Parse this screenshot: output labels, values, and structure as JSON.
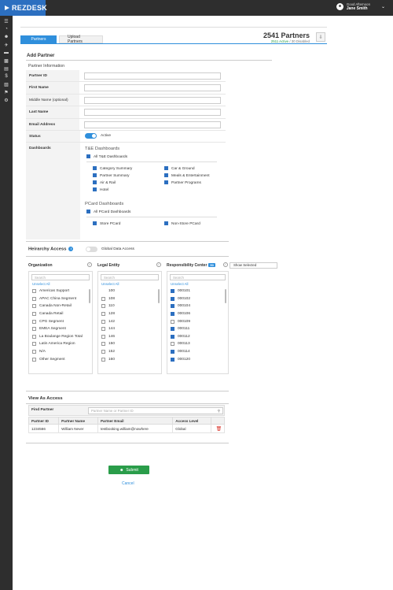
{
  "app": {
    "logo_text": "REZDESK",
    "greeting": "Good Afternoon",
    "user_name": "Jane Smith"
  },
  "sidebar": {
    "icons": [
      "menu-icon",
      "dashboard-icon",
      "user-icon",
      "plane-icon",
      "bed-icon",
      "car-icon",
      "file-icon",
      "dollar-icon",
      "book-icon",
      "flag-icon",
      "settings-icon"
    ]
  },
  "tabs": [
    {
      "label": "Partners"
    },
    {
      "label": "Upload Partners"
    }
  ],
  "summary": {
    "total": "2541 Partners",
    "active": "2511 Active",
    "sep": " / ",
    "disabled": "30 Disabled"
  },
  "add_partner": {
    "title": "Add Partner",
    "section": "Partner Information",
    "fields": [
      {
        "label": "Partner ID",
        "value": ""
      },
      {
        "label": "First Name",
        "value": ""
      },
      {
        "label": "Middle Name (optional)",
        "value": ""
      },
      {
        "label": "Last Name",
        "value": ""
      },
      {
        "label": "Email Address",
        "value": ""
      }
    ],
    "status_label": "Status",
    "status_value": "Active",
    "dashboards_label": "Dashboards"
  },
  "te": {
    "title": "T&E Dashboards",
    "all": "All T&E Dashboards",
    "left": [
      "Category Summary",
      "Partner Summary",
      "Air & Rail",
      "Hotel"
    ],
    "right": [
      "Car & Ground",
      "Meals & Entertainment",
      "Partner Programs"
    ]
  },
  "pcard": {
    "title": "PCard Dashboards",
    "all": "All PCard Dashboards",
    "items": [
      "Store PCard",
      "Non-Store PCard"
    ]
  },
  "hierarchy": {
    "title": "Heirarchy Access",
    "global_label": "Global Data Access",
    "show_selected": "Show Selected",
    "org": {
      "title": "Organization",
      "search": "Search",
      "unselect": "Unselect All",
      "items": [
        "Americas Support",
        "APAC China Segment",
        "Canada Non-Retail",
        "Canada Retail",
        "CPG Segment",
        "EMEA Segment",
        "La Boulange Region Total",
        "Latin America Region",
        "N/A",
        "Other Segment"
      ]
    },
    "legal": {
      "title": "Legal Entity",
      "search": "Search",
      "unselect": "Unselect All",
      "items": [
        "100",
        "108",
        "110",
        "128",
        "142",
        "144",
        "146",
        "150",
        "152",
        "160"
      ]
    },
    "resp": {
      "title": "Responsibility Center",
      "badge": "50",
      "search": "Search",
      "unselect": "Unselect All",
      "items": [
        {
          "v": "000101",
          "on": true
        },
        {
          "v": "000102",
          "on": true
        },
        {
          "v": "000104",
          "on": true
        },
        {
          "v": "000106",
          "on": true
        },
        {
          "v": "000109",
          "on": false
        },
        {
          "v": "000111",
          "on": true
        },
        {
          "v": "000112",
          "on": true
        },
        {
          "v": "000113",
          "on": false
        },
        {
          "v": "000114",
          "on": true
        },
        {
          "v": "000120",
          "on": true
        }
      ]
    }
  },
  "view_as": {
    "title": "View As Access",
    "find_label": "Find Partner",
    "find_placeholder": "Partner Name or Partner ID",
    "columns": [
      "Partner ID",
      "Partner Name",
      "Partner Email",
      "Access Level"
    ],
    "rows": [
      {
        "id": "1234566",
        "name": "William Never",
        "email": "testbooking.william@nowhere",
        "level": "Global"
      }
    ]
  },
  "actions": {
    "submit": "Submit",
    "cancel": "Cancel"
  }
}
